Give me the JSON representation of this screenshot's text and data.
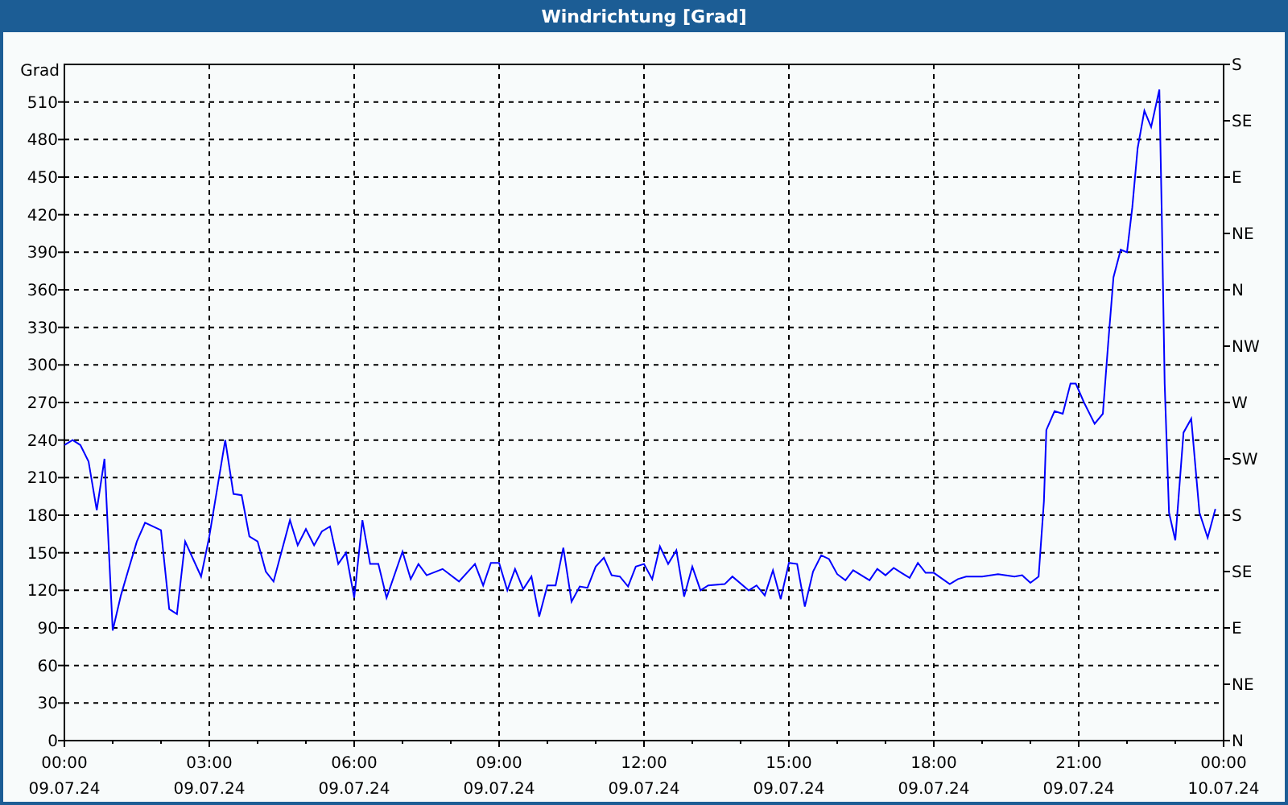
{
  "window": {
    "title": "Windrichtung [Grad]"
  },
  "chart": {
    "chart_data": {
      "type": "line",
      "grid": true,
      "ylabel": "Grad",
      "xlim": [
        0,
        24
      ],
      "ylim": [
        0,
        540
      ],
      "yticks": [
        0,
        30,
        60,
        90,
        120,
        150,
        180,
        210,
        240,
        270,
        300,
        330,
        360,
        390,
        420,
        450,
        480,
        510
      ],
      "xticks": [
        {
          "value": 0,
          "label": "00:00"
        },
        {
          "value": 3,
          "label": "03:00"
        },
        {
          "value": 6,
          "label": "06:00"
        },
        {
          "value": 9,
          "label": "09:00"
        },
        {
          "value": 12,
          "label": "12:00"
        },
        {
          "value": 15,
          "label": "15:00"
        },
        {
          "value": 18,
          "label": "18:00"
        },
        {
          "value": 21,
          "label": "21:00"
        },
        {
          "value": 24,
          "label": "00:00"
        }
      ],
      "x": [
        0,
        0.17,
        0.33,
        0.5,
        0.67,
        0.83,
        1,
        1.17,
        1.33,
        1.5,
        1.67,
        2,
        2.17,
        2.33,
        2.5,
        2.83,
        3,
        3.33,
        3.5,
        3.67,
        3.83,
        4,
        4.17,
        4.33,
        4.67,
        4.83,
        5,
        5.17,
        5.33,
        5.5,
        5.67,
        5.83,
        6,
        6.17,
        6.33,
        6.5,
        6.67,
        7,
        7.17,
        7.33,
        7.5,
        7.83,
        8.17,
        8.5,
        8.67,
        8.83,
        9,
        9.17,
        9.33,
        9.5,
        9.67,
        9.83,
        10,
        10.17,
        10.33,
        10.5,
        10.67,
        10.83,
        11,
        11.17,
        11.33,
        11.5,
        11.67,
        11.83,
        12,
        12.17,
        12.33,
        12.5,
        12.67,
        12.83,
        13,
        13.17,
        13.33,
        13.67,
        13.83,
        14.17,
        14.33,
        14.5,
        14.67,
        14.83,
        15,
        15.17,
        15.33,
        15.5,
        15.67,
        15.83,
        16,
        16.17,
        16.33,
        16.67,
        16.83,
        17,
        17.17,
        17.33,
        17.5,
        17.67,
        17.83,
        18,
        18.33,
        18.5,
        18.67,
        19,
        19.33,
        19.67,
        19.83,
        20,
        20.17,
        20.28,
        20.33,
        20.5,
        20.67,
        20.83,
        20.94,
        21.11,
        21.33,
        21.5,
        21.61,
        21.72,
        21.87,
        22,
        22.11,
        22.22,
        22.36,
        22.5,
        22.67,
        22.72,
        22.78,
        22.87,
        23,
        23.17,
        23.33,
        23.5,
        23.67,
        23.83
      ],
      "series": [
        {
          "color": "#0000ff",
          "values": [
            236,
            240,
            236,
            223,
            184,
            225,
            88,
            116,
            137,
            159,
            174,
            168,
            105,
            101,
            159,
            131,
            163,
            240,
            197,
            196,
            163,
            159,
            135,
            127,
            176,
            156,
            169,
            156,
            167,
            171,
            141,
            150,
            114,
            176,
            141,
            141,
            114,
            151,
            129,
            141,
            132,
            137,
            127,
            141,
            124,
            142,
            142,
            120,
            137,
            121,
            131,
            99,
            124,
            124,
            154,
            111,
            123,
            122,
            139,
            146,
            132,
            131,
            123,
            139,
            141,
            129,
            155,
            141,
            152,
            115,
            139,
            120,
            124,
            125,
            131,
            120,
            124,
            116,
            136,
            113,
            142,
            141,
            107,
            135,
            148,
            145,
            133,
            128,
            136,
            128,
            137,
            132,
            138,
            134,
            130,
            142,
            134,
            134,
            125,
            129,
            131,
            131,
            133,
            131,
            132,
            126,
            131,
            191,
            248,
            263,
            261,
            285,
            285,
            270,
            253,
            261,
            317,
            370,
            392,
            390,
            426,
            473,
            503,
            490,
            520,
            420,
            285,
            182,
            160,
            246,
            257,
            182,
            162,
            185
          ]
        }
      ]
    },
    "compass_labels": [
      "S",
      "SE",
      "E",
      "NE",
      "N",
      "NW",
      "W",
      "SW",
      "S",
      "SE",
      "E",
      "NE",
      "N"
    ],
    "xtick_dates": [
      "09.07.24",
      "09.07.24",
      "09.07.24",
      "09.07.24",
      "09.07.24",
      "09.07.24",
      "09.07.24",
      "09.07.24",
      "10.07.24"
    ]
  }
}
